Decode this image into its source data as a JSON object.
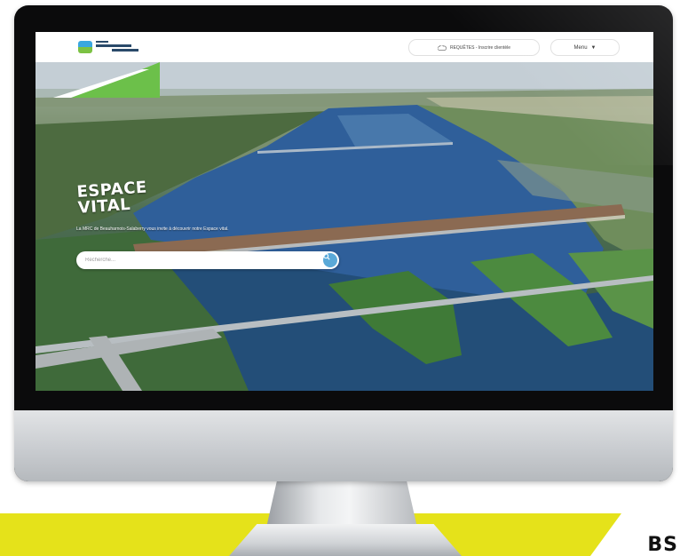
{
  "header": {
    "pill_text": "REQUÊTES - Inscrire clientèle",
    "menu_label": "Menu",
    "cloud_icon": "cloud-icon",
    "caret_icon": "caret-down-icon"
  },
  "hero": {
    "title_line1": "ESPACE",
    "title_line2": "VITAL",
    "subtitle": "La MRC de Beauharnois-Salaberry vous invite à découvrir notre Espace vital.",
    "search_placeholder": "Recherche...",
    "search_icon": "search-icon"
  },
  "corner_text": "BS",
  "colors": {
    "banner": "#e5e21a",
    "accent_green": "#6cc04a",
    "search_button": "#5aa9d8"
  }
}
